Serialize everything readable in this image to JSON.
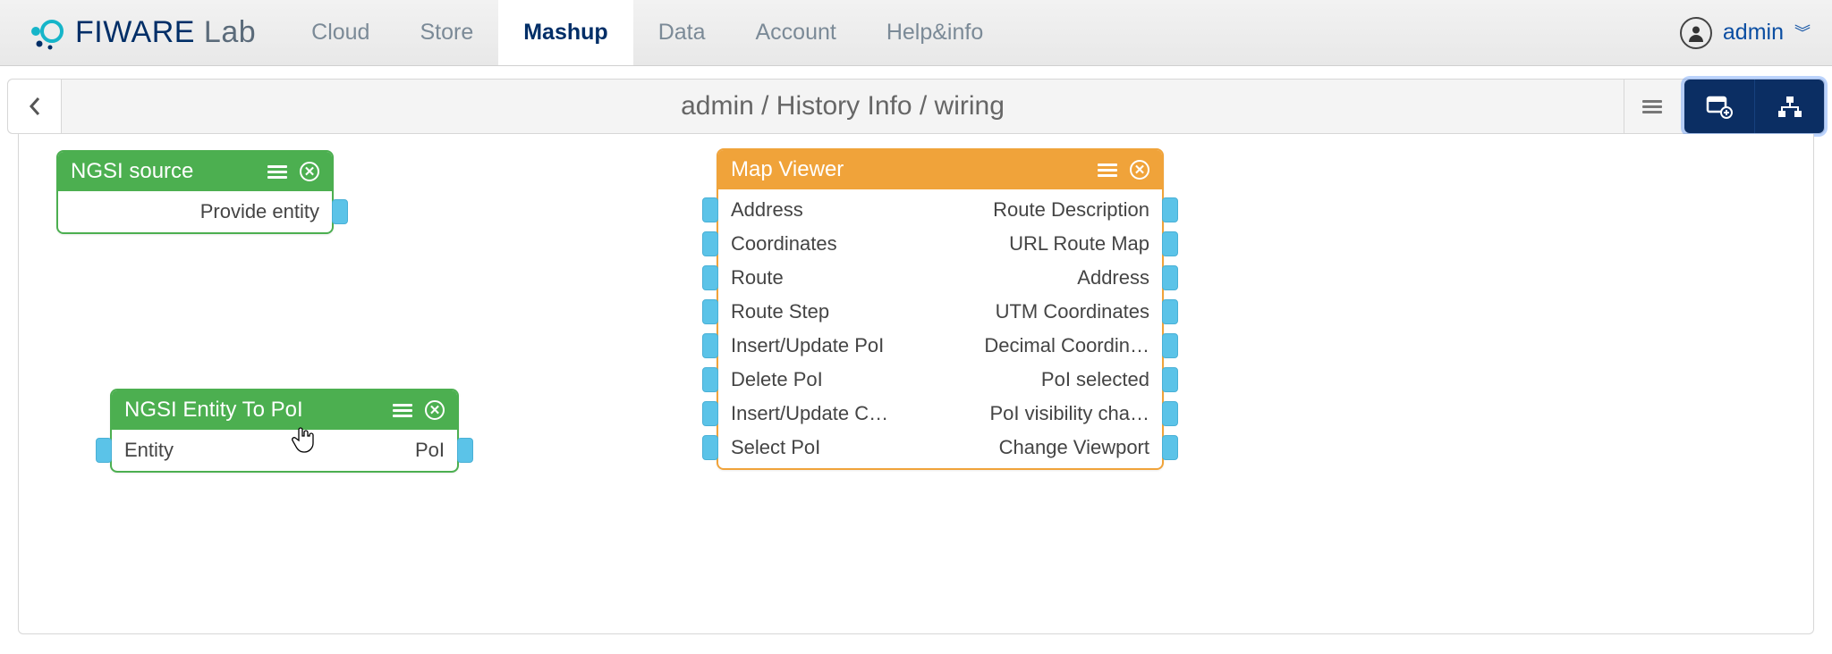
{
  "brand": {
    "name": "FIWARE",
    "suffix": "Lab"
  },
  "nav": {
    "items": [
      {
        "label": "Cloud",
        "active": false
      },
      {
        "label": "Store",
        "active": false
      },
      {
        "label": "Mashup",
        "active": true
      },
      {
        "label": "Data",
        "active": false
      },
      {
        "label": "Account",
        "active": false
      },
      {
        "label": "Help&info",
        "active": false
      }
    ]
  },
  "user": {
    "name": "admin"
  },
  "breadcrumb": "admin / History Info / wiring",
  "toolbar": {
    "back": "back",
    "menu": "menu",
    "add_widget": "add-widget",
    "wiring_view": "wiring-view"
  },
  "nodes": {
    "ngsi_source": {
      "title": "NGSI source",
      "outputs": [
        "Provide entity"
      ]
    },
    "ngsi_entity_to_poi": {
      "title": "NGSI Entity To PoI",
      "inputs": [
        "Entity"
      ],
      "outputs": [
        "PoI"
      ]
    },
    "map_viewer": {
      "title": "Map Viewer",
      "rows": [
        {
          "in": "Address",
          "out": "Route Description"
        },
        {
          "in": "Coordinates",
          "out": "URL Route Map"
        },
        {
          "in": "Route",
          "out": "Address"
        },
        {
          "in": "Route Step",
          "out": "UTM Coordinates"
        },
        {
          "in": "Insert/Update PoI",
          "out": "Decimal Coordin…"
        },
        {
          "in": "Delete PoI",
          "out": "PoI selected"
        },
        {
          "in": "Insert/Update C…",
          "out": "PoI visibility cha…"
        },
        {
          "in": "Select PoI",
          "out": "Change Viewport"
        }
      ]
    }
  }
}
